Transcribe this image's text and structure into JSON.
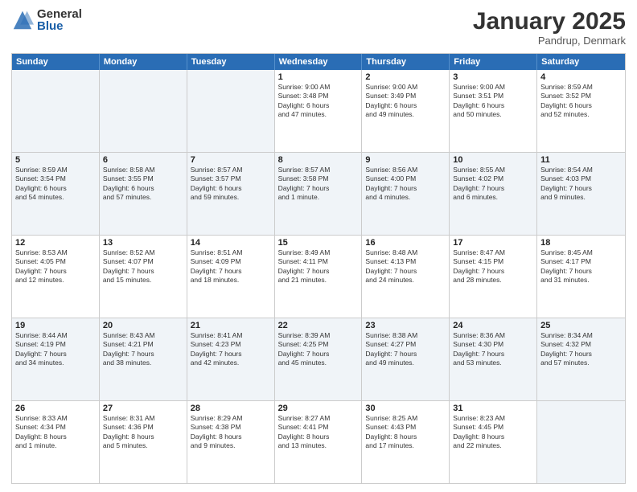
{
  "logo": {
    "general": "General",
    "blue": "Blue"
  },
  "header": {
    "title": "January 2025",
    "location": "Pandrup, Denmark"
  },
  "weekdays": [
    "Sunday",
    "Monday",
    "Tuesday",
    "Wednesday",
    "Thursday",
    "Friday",
    "Saturday"
  ],
  "weeks": [
    [
      {
        "day": "",
        "info": ""
      },
      {
        "day": "",
        "info": ""
      },
      {
        "day": "",
        "info": ""
      },
      {
        "day": "1",
        "info": "Sunrise: 9:00 AM\nSunset: 3:48 PM\nDaylight: 6 hours\nand 47 minutes."
      },
      {
        "day": "2",
        "info": "Sunrise: 9:00 AM\nSunset: 3:49 PM\nDaylight: 6 hours\nand 49 minutes."
      },
      {
        "day": "3",
        "info": "Sunrise: 9:00 AM\nSunset: 3:51 PM\nDaylight: 6 hours\nand 50 minutes."
      },
      {
        "day": "4",
        "info": "Sunrise: 8:59 AM\nSunset: 3:52 PM\nDaylight: 6 hours\nand 52 minutes."
      }
    ],
    [
      {
        "day": "5",
        "info": "Sunrise: 8:59 AM\nSunset: 3:54 PM\nDaylight: 6 hours\nand 54 minutes."
      },
      {
        "day": "6",
        "info": "Sunrise: 8:58 AM\nSunset: 3:55 PM\nDaylight: 6 hours\nand 57 minutes."
      },
      {
        "day": "7",
        "info": "Sunrise: 8:57 AM\nSunset: 3:57 PM\nDaylight: 6 hours\nand 59 minutes."
      },
      {
        "day": "8",
        "info": "Sunrise: 8:57 AM\nSunset: 3:58 PM\nDaylight: 7 hours\nand 1 minute."
      },
      {
        "day": "9",
        "info": "Sunrise: 8:56 AM\nSunset: 4:00 PM\nDaylight: 7 hours\nand 4 minutes."
      },
      {
        "day": "10",
        "info": "Sunrise: 8:55 AM\nSunset: 4:02 PM\nDaylight: 7 hours\nand 6 minutes."
      },
      {
        "day": "11",
        "info": "Sunrise: 8:54 AM\nSunset: 4:03 PM\nDaylight: 7 hours\nand 9 minutes."
      }
    ],
    [
      {
        "day": "12",
        "info": "Sunrise: 8:53 AM\nSunset: 4:05 PM\nDaylight: 7 hours\nand 12 minutes."
      },
      {
        "day": "13",
        "info": "Sunrise: 8:52 AM\nSunset: 4:07 PM\nDaylight: 7 hours\nand 15 minutes."
      },
      {
        "day": "14",
        "info": "Sunrise: 8:51 AM\nSunset: 4:09 PM\nDaylight: 7 hours\nand 18 minutes."
      },
      {
        "day": "15",
        "info": "Sunrise: 8:49 AM\nSunset: 4:11 PM\nDaylight: 7 hours\nand 21 minutes."
      },
      {
        "day": "16",
        "info": "Sunrise: 8:48 AM\nSunset: 4:13 PM\nDaylight: 7 hours\nand 24 minutes."
      },
      {
        "day": "17",
        "info": "Sunrise: 8:47 AM\nSunset: 4:15 PM\nDaylight: 7 hours\nand 28 minutes."
      },
      {
        "day": "18",
        "info": "Sunrise: 8:45 AM\nSunset: 4:17 PM\nDaylight: 7 hours\nand 31 minutes."
      }
    ],
    [
      {
        "day": "19",
        "info": "Sunrise: 8:44 AM\nSunset: 4:19 PM\nDaylight: 7 hours\nand 34 minutes."
      },
      {
        "day": "20",
        "info": "Sunrise: 8:43 AM\nSunset: 4:21 PM\nDaylight: 7 hours\nand 38 minutes."
      },
      {
        "day": "21",
        "info": "Sunrise: 8:41 AM\nSunset: 4:23 PM\nDaylight: 7 hours\nand 42 minutes."
      },
      {
        "day": "22",
        "info": "Sunrise: 8:39 AM\nSunset: 4:25 PM\nDaylight: 7 hours\nand 45 minutes."
      },
      {
        "day": "23",
        "info": "Sunrise: 8:38 AM\nSunset: 4:27 PM\nDaylight: 7 hours\nand 49 minutes."
      },
      {
        "day": "24",
        "info": "Sunrise: 8:36 AM\nSunset: 4:30 PM\nDaylight: 7 hours\nand 53 minutes."
      },
      {
        "day": "25",
        "info": "Sunrise: 8:34 AM\nSunset: 4:32 PM\nDaylight: 7 hours\nand 57 minutes."
      }
    ],
    [
      {
        "day": "26",
        "info": "Sunrise: 8:33 AM\nSunset: 4:34 PM\nDaylight: 8 hours\nand 1 minute."
      },
      {
        "day": "27",
        "info": "Sunrise: 8:31 AM\nSunset: 4:36 PM\nDaylight: 8 hours\nand 5 minutes."
      },
      {
        "day": "28",
        "info": "Sunrise: 8:29 AM\nSunset: 4:38 PM\nDaylight: 8 hours\nand 9 minutes."
      },
      {
        "day": "29",
        "info": "Sunrise: 8:27 AM\nSunset: 4:41 PM\nDaylight: 8 hours\nand 13 minutes."
      },
      {
        "day": "30",
        "info": "Sunrise: 8:25 AM\nSunset: 4:43 PM\nDaylight: 8 hours\nand 17 minutes."
      },
      {
        "day": "31",
        "info": "Sunrise: 8:23 AM\nSunset: 4:45 PM\nDaylight: 8 hours\nand 22 minutes."
      },
      {
        "day": "",
        "info": ""
      }
    ]
  ]
}
